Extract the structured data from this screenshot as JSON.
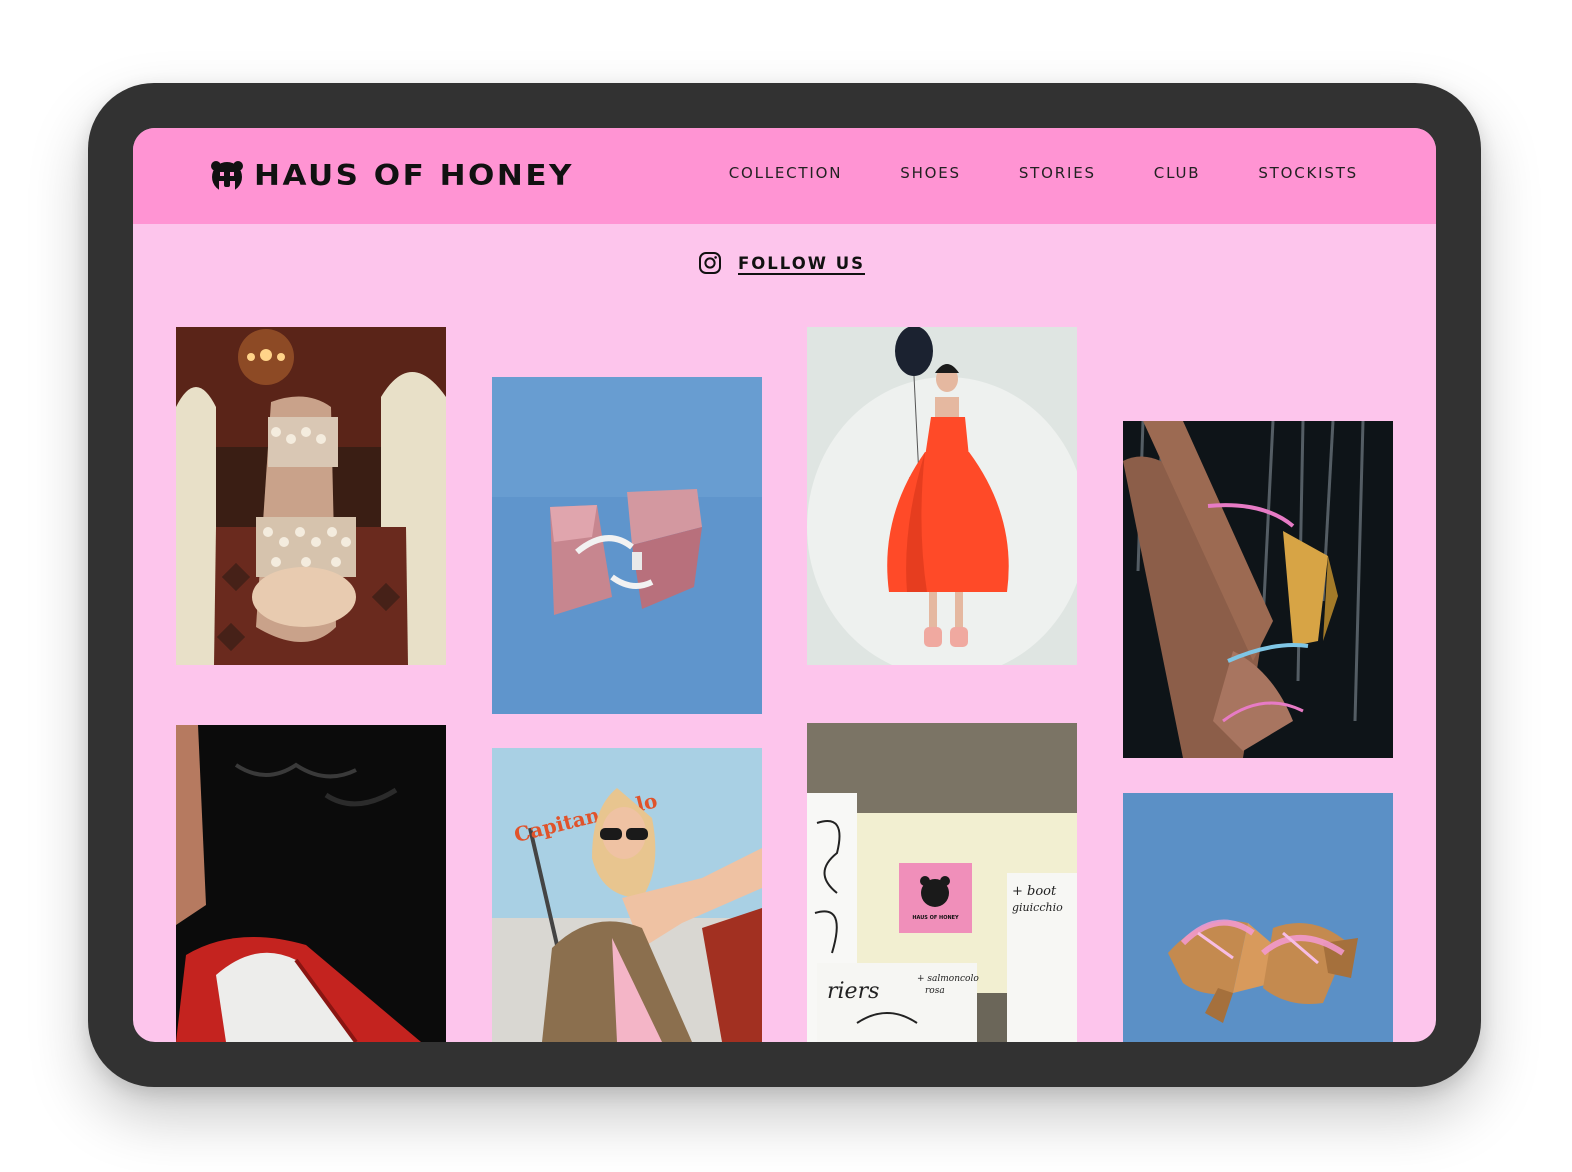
{
  "brand": {
    "name": "HAUS OF HONEY",
    "logo_icon": "bear-icon"
  },
  "nav": [
    "COLLECTION",
    "SHOES",
    "STORIES",
    "CLUB",
    "STOCKISTS"
  ],
  "follow": {
    "label": "FOLLOW US",
    "icon": "instagram-icon"
  },
  "gallery": {
    "photo_6_sign": "Capitan Italo",
    "photo_7_poster_logo": "HAUS OF HONEY",
    "photo_7_notes": [
      "+ boot",
      "giuicchio",
      "riers",
      "+ salmoncolo",
      "rosa"
    ]
  },
  "colors": {
    "header_bg": "#ff94d3",
    "page_bg": "#fdc5ec",
    "device_frame": "#323232",
    "text": "#111111"
  }
}
